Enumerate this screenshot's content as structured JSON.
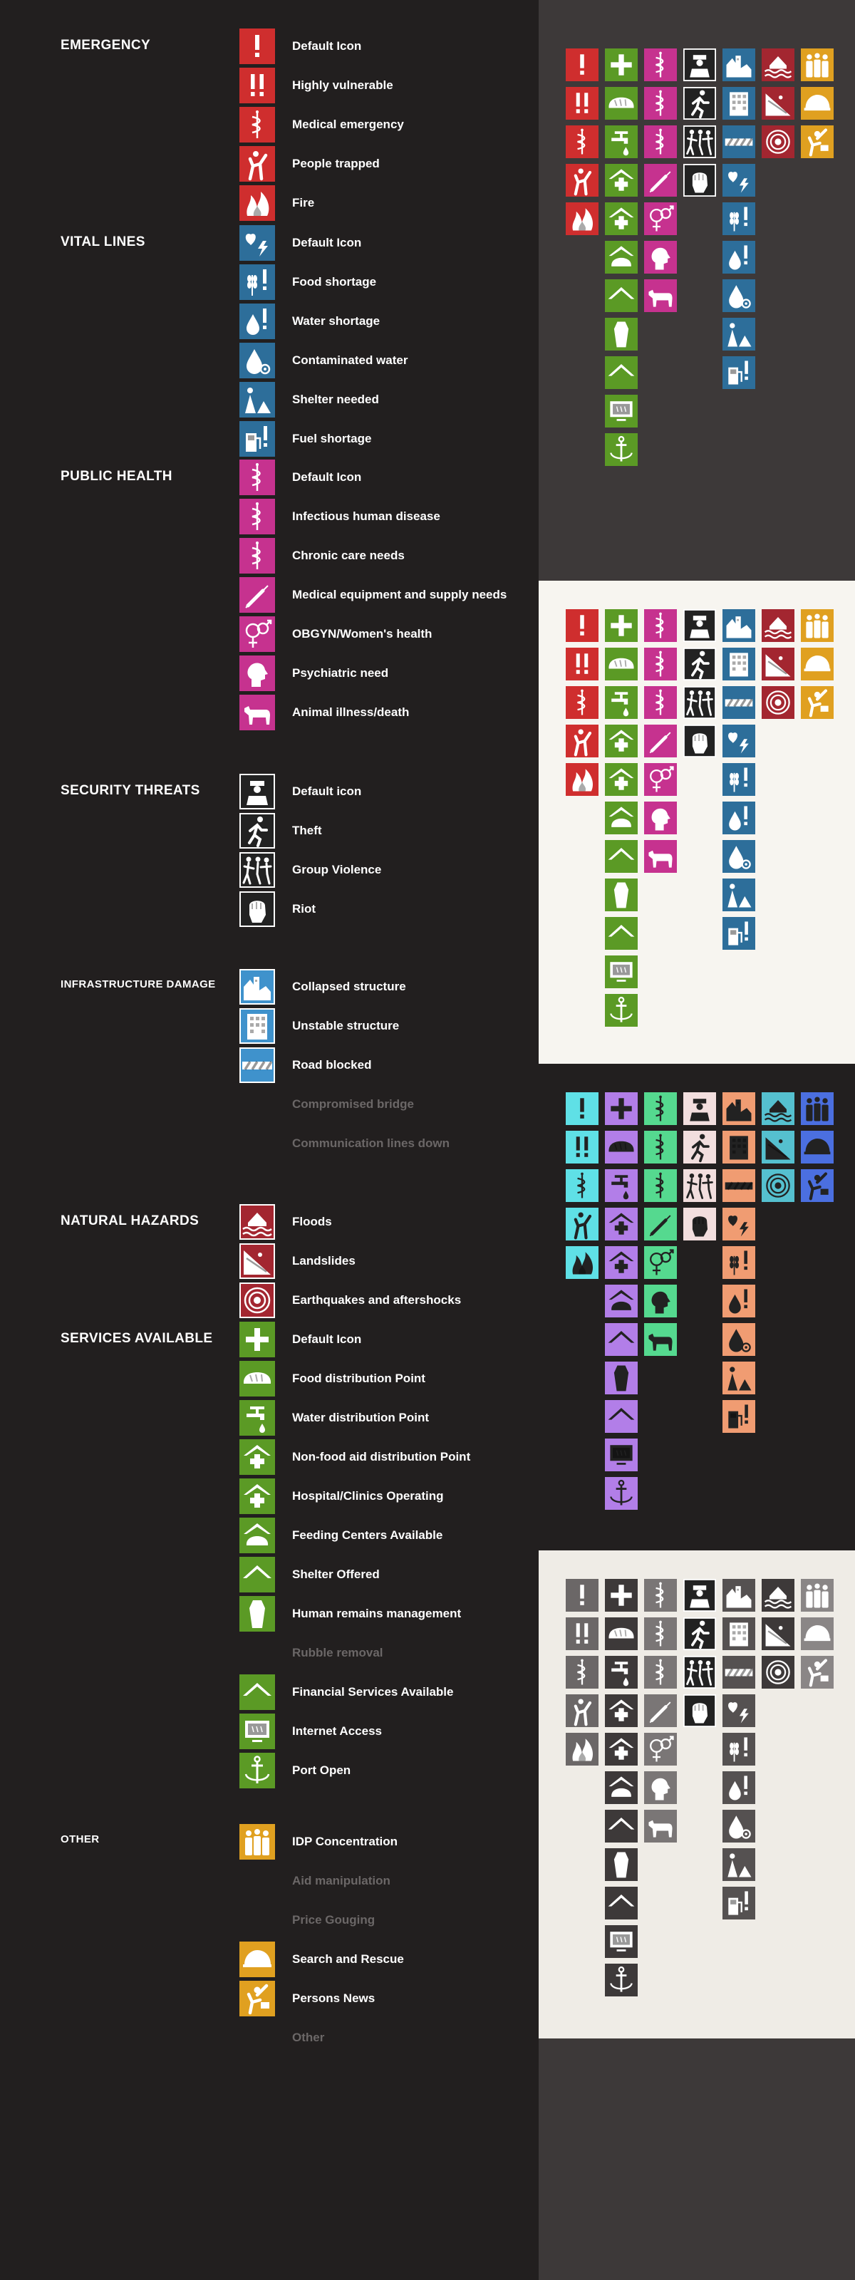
{
  "colors": {
    "emergency": "#cf2e2e",
    "vital": "#2d6e9a",
    "health": "#c6328f",
    "security": "#222222",
    "infra": "#3f92cc",
    "hazard": "#a32630",
    "services": "#5b9a25",
    "other": "#e0a020"
  },
  "sections": [
    {
      "title": "EMERGENCY",
      "style": "normal",
      "top": 0,
      "rows": [
        {
          "label": "Default Icon",
          "icon": "exclamation-icon",
          "cat": "emergency"
        },
        {
          "label": "Highly vulnerable",
          "icon": "double-exclamation-icon",
          "cat": "emergency"
        },
        {
          "label": "Medical emergency",
          "icon": "caduceus-icon",
          "cat": "emergency"
        },
        {
          "label": "People trapped",
          "icon": "person-trapped-icon",
          "cat": "emergency"
        },
        {
          "label": "Fire",
          "icon": "fire-icon",
          "cat": "emergency"
        }
      ]
    },
    {
      "title": "VITAL LINES",
      "style": "normal",
      "rows": [
        {
          "label": "Default Icon",
          "icon": "heart-bolt-icon",
          "cat": "vital"
        },
        {
          "label": "Food shortage",
          "icon": "wheat-exclamation-icon",
          "cat": "vital"
        },
        {
          "label": "Water shortage",
          "icon": "drop-exclamation-icon",
          "cat": "vital"
        },
        {
          "label": "Contaminated water",
          "icon": "drop-biohazard-icon",
          "cat": "vital"
        },
        {
          "label": "Shelter needed",
          "icon": "person-tent-icon",
          "cat": "vital"
        },
        {
          "label": "Fuel shortage",
          "icon": "fuel-exclamation-icon",
          "cat": "vital"
        }
      ]
    },
    {
      "title": "PUBLIC HEALTH",
      "style": "normal",
      "rows": [
        {
          "label": "Default Icon",
          "icon": "caduceus-icon",
          "cat": "health"
        },
        {
          "label": "Infectious human disease",
          "icon": "caduceus-icon",
          "cat": "health"
        },
        {
          "label": "Chronic care needs",
          "icon": "caduceus-icon",
          "cat": "health"
        },
        {
          "label": "Medical equipment and supply needs",
          "icon": "syringe-icon",
          "cat": "health"
        },
        {
          "label": "OBGYN/Women's health",
          "icon": "gender-icon",
          "cat": "health"
        },
        {
          "label": "Psychiatric need",
          "icon": "head-icon",
          "cat": "health"
        },
        {
          "label": "Animal illness/death",
          "icon": "cow-icon",
          "cat": "health"
        }
      ]
    },
    {
      "title": "SECURITY THREATS",
      "style": "normal",
      "rows": [
        {
          "label": "Default icon",
          "icon": "police-icon",
          "cat": "security"
        },
        {
          "label": "Theft",
          "icon": "running-thief-icon",
          "cat": "security"
        },
        {
          "label": "Group Violence",
          "icon": "group-violence-icon",
          "cat": "security"
        },
        {
          "label": "Riot",
          "icon": "fist-icon",
          "cat": "security"
        }
      ]
    },
    {
      "title": "INFRASTRUCTURE DAMAGE",
      "style": "small",
      "rows": [
        {
          "label": "Collapsed structure",
          "icon": "collapsed-building-icon",
          "cat": "infra"
        },
        {
          "label": "Unstable structure",
          "icon": "building-icon",
          "cat": "infra"
        },
        {
          "label": "Road blocked",
          "icon": "road-block-icon",
          "cat": "infra"
        },
        {
          "label": "Compromised bridge",
          "icon": "",
          "cat": "none",
          "disabled": true
        },
        {
          "label": "Communication lines down",
          "icon": "",
          "cat": "none",
          "disabled": true
        }
      ]
    },
    {
      "title": "NATURAL HAZARDS",
      "style": "normal",
      "rows": [
        {
          "label": "Floods",
          "icon": "flood-icon",
          "cat": "hazard"
        },
        {
          "label": "Landslides",
          "icon": "landslide-icon",
          "cat": "hazard"
        },
        {
          "label": "Earthquakes and aftershocks",
          "icon": "target-icon",
          "cat": "hazard"
        }
      ]
    },
    {
      "title": "SERVICES AVAILABLE",
      "style": "normal",
      "rows": [
        {
          "label": "Default Icon",
          "icon": "plus-icon",
          "cat": "services"
        },
        {
          "label": "Food distribution Point",
          "icon": "bread-icon",
          "cat": "services"
        },
        {
          "label": "Water distribution Point",
          "icon": "faucet-icon",
          "cat": "services"
        },
        {
          "label": "Non-food aid distribution Point",
          "icon": "house-plus-icon",
          "cat": "services"
        },
        {
          "label": "Hospital/Clinics Operating",
          "icon": "house-plus-icon",
          "cat": "services"
        },
        {
          "label": "Feeding Centers Available",
          "icon": "roof-bread-icon",
          "cat": "services"
        },
        {
          "label": "Shelter Offered",
          "icon": "roof-icon",
          "cat": "services"
        },
        {
          "label": "Human remains management",
          "icon": "coffin-icon",
          "cat": "services"
        },
        {
          "label": "Rubble removal",
          "icon": "",
          "cat": "none",
          "disabled": true
        },
        {
          "label": "Financial Services Available",
          "icon": "roof-icon",
          "cat": "services"
        },
        {
          "label": "Internet Access",
          "icon": "computer-icon",
          "cat": "services"
        },
        {
          "label": "Port Open",
          "icon": "anchor-icon",
          "cat": "services"
        }
      ]
    },
    {
      "title": "OTHER",
      "style": "small",
      "rows": [
        {
          "label": "IDP Concentration",
          "icon": "people-group-icon",
          "cat": "other"
        },
        {
          "label": "Aid manipulation",
          "icon": "",
          "cat": "none",
          "disabled": true
        },
        {
          "label": "Price Gouging",
          "icon": "",
          "cat": "none",
          "disabled": true
        },
        {
          "label": "Search and Rescue",
          "icon": "helmet-icon",
          "cat": "other"
        },
        {
          "label": "Persons News",
          "icon": "person-news-icon",
          "cat": "other"
        },
        {
          "label": "Other",
          "icon": "",
          "cat": "none",
          "disabled": true
        }
      ]
    }
  ],
  "grid_columns": [
    [
      "exclamation-icon",
      "double-exclamation-icon",
      "caduceus-icon",
      "person-trapped-icon",
      "fire-icon"
    ],
    [
      "plus-icon",
      "bread-icon",
      "faucet-icon",
      "house-plus-icon",
      "house-plus-icon",
      "roof-bread-icon",
      "roof-icon",
      "coffin-icon",
      "roof-icon",
      "computer-icon",
      "anchor-icon"
    ],
    [
      "caduceus-icon",
      "caduceus-icon",
      "caduceus-icon",
      "syringe-icon",
      "gender-icon",
      "head-icon",
      "cow-icon"
    ],
    [
      "police-icon",
      "running-thief-icon",
      "group-violence-icon",
      "fist-icon"
    ],
    [
      "collapsed-building-icon",
      "building-icon",
      "road-block-icon",
      "heart-bolt-icon",
      "wheat-exclamation-icon",
      "drop-exclamation-icon",
      "drop-biohazard-icon",
      "person-tent-icon",
      "fuel-exclamation-icon"
    ],
    [
      "flood-icon",
      "landslide-icon",
      "target-icon"
    ],
    [
      "people-group-icon",
      "helmet-icon",
      "person-news-icon"
    ]
  ],
  "panels": [
    {
      "name": "dark",
      "bg": "#3d3939",
      "stroke": "#ffffff",
      "fill": "#ffffff",
      "col_colors": [
        "#cf2e2e",
        "#5b9a25",
        "#c6328f",
        "#222222",
        "#2d6e9a",
        "#a32630",
        "#e0a020"
      ]
    },
    {
      "name": "light",
      "bg": "#f7f5f0",
      "stroke": "#ffffff",
      "fill": "#ffffff",
      "col_colors": [
        "#cf2e2e",
        "#5b9a25",
        "#c6328f",
        "#222222",
        "#2d6e9a",
        "#a32630",
        "#e0a020"
      ]
    },
    {
      "name": "neon",
      "bg": "#221f1f",
      "stroke": "#222222",
      "fill": "#222222",
      "col_colors": [
        "#5fe0e6",
        "#b27ee8",
        "#55d98f",
        "#f2dede",
        "#f09c72",
        "#55c0cf",
        "#4b6fe0"
      ]
    },
    {
      "name": "grey",
      "bg": "#efece6",
      "stroke": "#ffffff",
      "fill": "#ffffff",
      "col_colors": [
        "#6b6767",
        "#3d3939",
        "#7a7676",
        "#222222",
        "#555151",
        "#3d3939",
        "#8a8686"
      ]
    }
  ]
}
